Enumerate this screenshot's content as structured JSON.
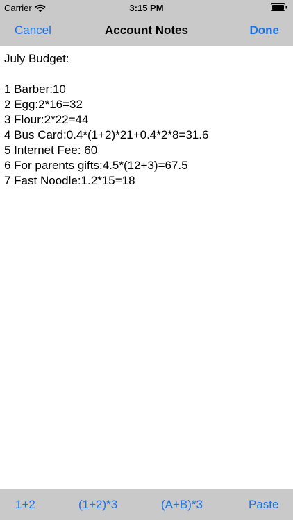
{
  "status_bar": {
    "carrier": "Carrier",
    "time": "3:15 PM",
    "wifi_icon": "wifi-icon",
    "battery_icon": "battery-icon"
  },
  "nav_bar": {
    "cancel_label": "Cancel",
    "title": "Account Notes",
    "done_label": "Done"
  },
  "notes": {
    "lines": [
      "July Budget:",
      "",
      "1 Barber:10",
      "2 Egg:2*16=32",
      "3 Flour:2*22=44",
      "4 Bus Card:0.4*(1+2)*21+0.4*2*8=31.6",
      "5 Internet Fee: 60",
      "6 For parents gifts:4.5*(12+3)=67.5",
      "7 Fast Noodle:1.2*15=18"
    ]
  },
  "toolbar": {
    "buttons": [
      "1+2",
      "(1+2)*3",
      "(A+B)*3",
      "Paste"
    ]
  },
  "colors": {
    "accent": "#1a73e8",
    "bar_background": "#c9c9c9"
  }
}
